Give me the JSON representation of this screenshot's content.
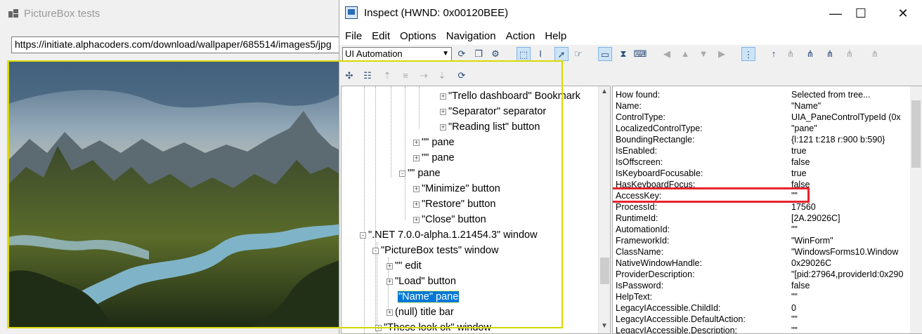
{
  "background_window": {
    "title": "PictureBox tests",
    "url": "https://initiate.alphacoders.com/download/wallpaper/685514/images5/jpg"
  },
  "inspect": {
    "title": "Inspect  (HWND: 0x00120BEE)",
    "window_buttons": {
      "minimize": "—",
      "maximize": "☐",
      "close": "✕"
    },
    "menu": [
      "File",
      "Edit",
      "Options",
      "Navigation",
      "Action",
      "Help"
    ],
    "mode_combo": "UI Automation",
    "tree": [
      {
        "label": "\"Trello dashboard\" Bookmark",
        "expander": "+",
        "selected": false
      },
      {
        "label": "\"Separator\" separator",
        "expander": "+",
        "selected": false
      },
      {
        "label": "\"Reading list\" button",
        "expander": "+",
        "selected": false
      },
      {
        "label": "\"\" pane",
        "expander": "+",
        "selected": false
      },
      {
        "label": "\"\" pane",
        "expander": "+",
        "selected": false
      },
      {
        "label": "\"\" pane",
        "expander": "-",
        "selected": false
      },
      {
        "label": "\"Minimize\" button",
        "expander": "+",
        "selected": false
      },
      {
        "label": "\"Restore\" button",
        "expander": "+",
        "selected": false
      },
      {
        "label": "\"Close\" button",
        "expander": "+",
        "selected": false
      },
      {
        "label": "\".NET 7.0.0-alpha.1.21454.3\" window",
        "expander": "-",
        "selected": false
      },
      {
        "label": "\"PictureBox tests\" window",
        "expander": "-",
        "selected": false
      },
      {
        "label": "\"\" edit",
        "expander": "+",
        "selected": false
      },
      {
        "label": "\"Load\" button",
        "expander": "+",
        "selected": false
      },
      {
        "label": "\"Name\" pane",
        "expander": "",
        "selected": true
      },
      {
        "label": "(null) title bar",
        "expander": "+",
        "selected": false
      },
      {
        "label": "\"These look ok\" window",
        "expander": "+",
        "selected": false
      }
    ],
    "properties": [
      {
        "k": "How found:",
        "v": "Selected from tree..."
      },
      {
        "k": "Name:",
        "v": "\"Name\""
      },
      {
        "k": "ControlType:",
        "v": "UIA_PaneControlTypeId (0x"
      },
      {
        "k": "LocalizedControlType:",
        "v": "\"pane\""
      },
      {
        "k": "BoundingRectangle:",
        "v": "{l:121 t:218 r:900 b:590}"
      },
      {
        "k": "IsEnabled:",
        "v": "true"
      },
      {
        "k": "IsOffscreen:",
        "v": "false"
      },
      {
        "k": "IsKeyboardFocusable:",
        "v": "true"
      },
      {
        "k": "HasKeyboardFocus:",
        "v": "false"
      },
      {
        "k": "AccessKey:",
        "v": "\"\""
      },
      {
        "k": "ProcessId:",
        "v": "17560"
      },
      {
        "k": "RuntimeId:",
        "v": "[2A.29026C]"
      },
      {
        "k": "AutomationId:",
        "v": "\"\""
      },
      {
        "k": "FrameworkId:",
        "v": "\"WinForm\""
      },
      {
        "k": "ClassName:",
        "v": "\"WindowsForms10.Window"
      },
      {
        "k": "NativeWindowHandle:",
        "v": "0x29026C"
      },
      {
        "k": "ProviderDescription:",
        "v": "\"[pid:27964,providerId:0x290"
      },
      {
        "k": "IsPassword:",
        "v": "false"
      },
      {
        "k": "HelpText:",
        "v": "\"\""
      },
      {
        "k": "LegacyIAccessible.ChildId:",
        "v": "0"
      },
      {
        "k": "LegacyIAccessible.DefaultAction:",
        "v": "\"\""
      },
      {
        "k": "LegacyIAccessible.Description:",
        "v": "\"\""
      }
    ],
    "highlighted_property": "AccessKey:",
    "colors": {
      "highlight_box": "#e8232c",
      "selection": "#0078d7",
      "focus_outline": "#d9d900"
    }
  }
}
